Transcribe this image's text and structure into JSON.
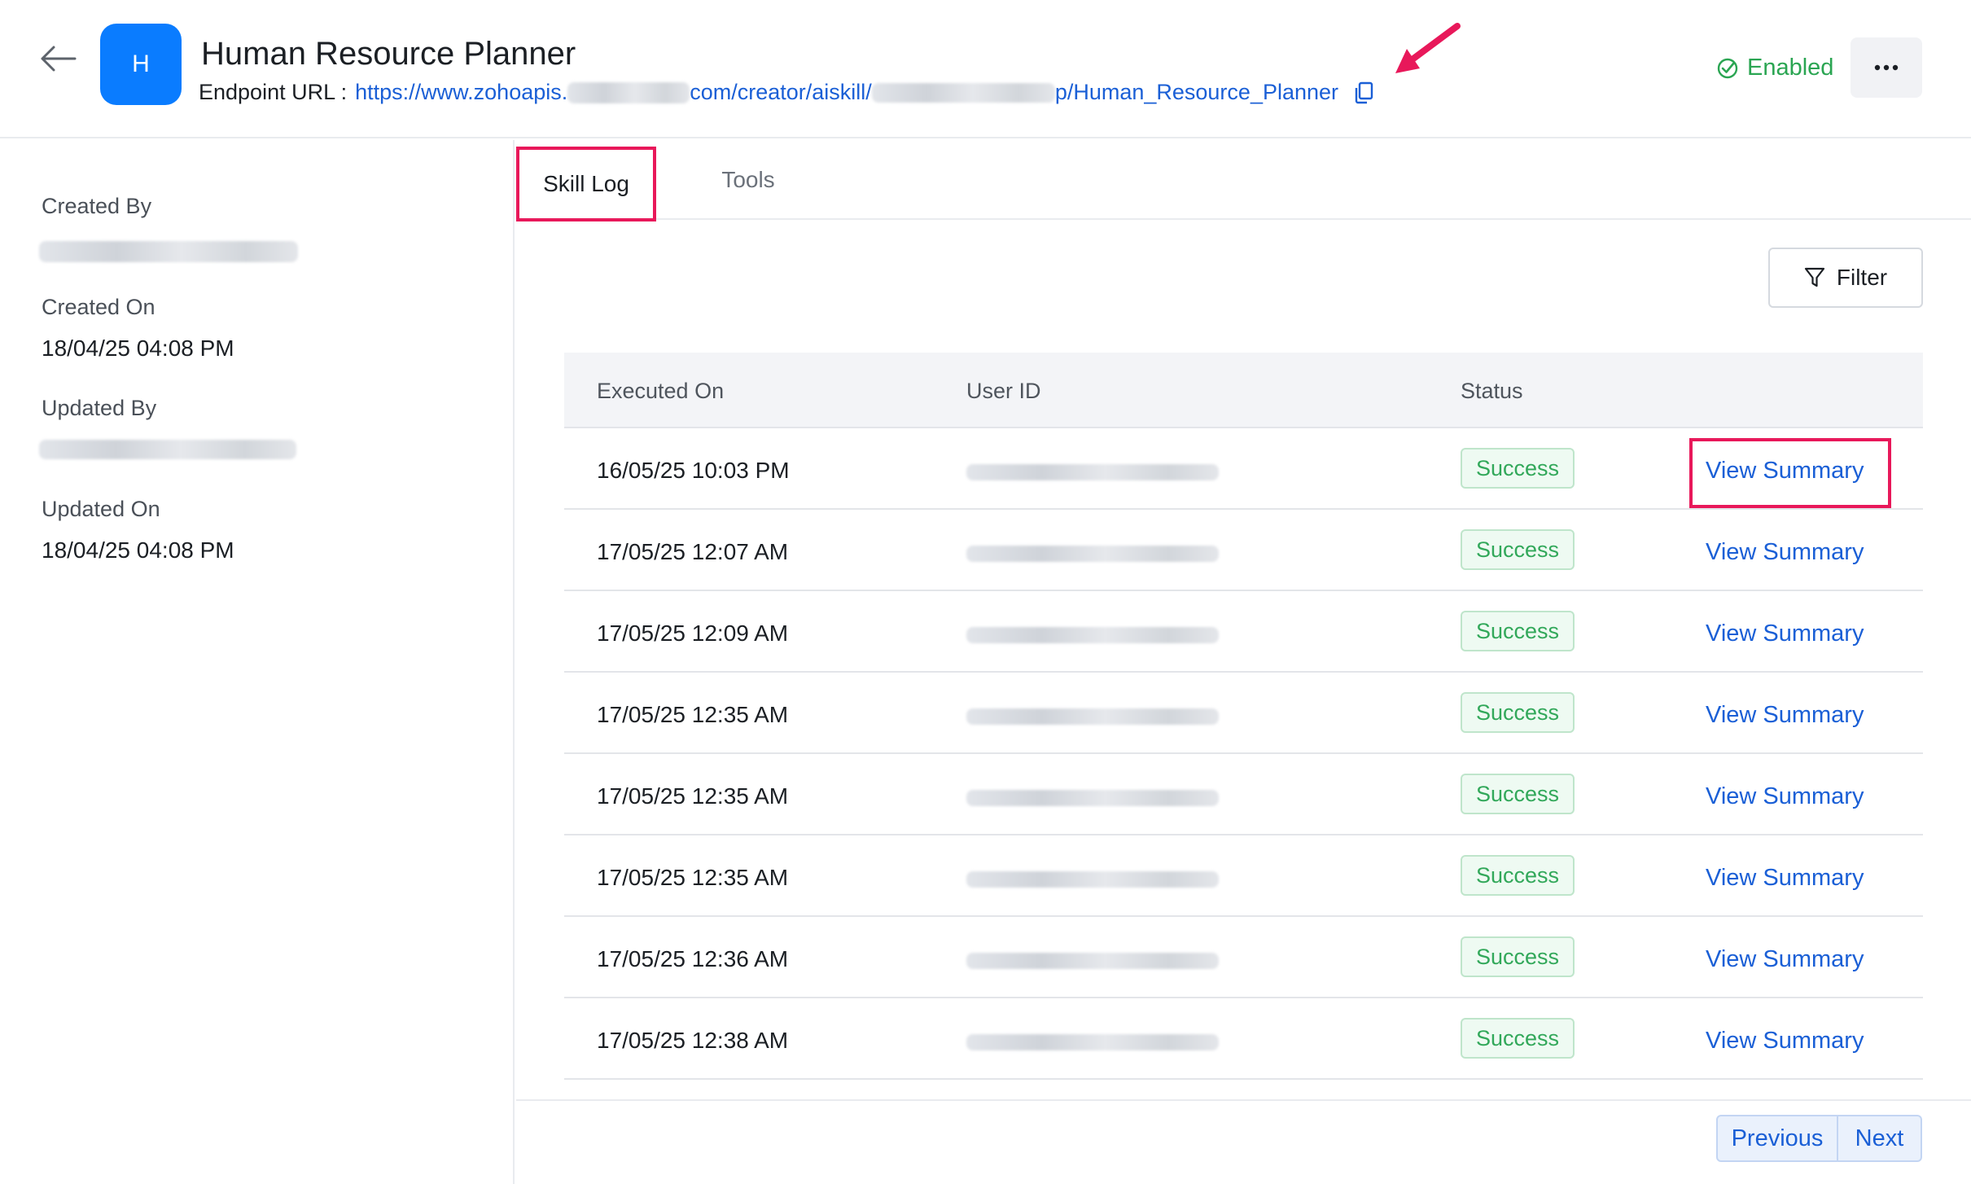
{
  "header": {
    "avatar_letter": "H",
    "title": "Human Resource Planner",
    "endpoint_label": "Endpoint URL :",
    "url_part1": "https://www.zohoapis.",
    "url_part2": "com/creator/aiskill/",
    "url_part3": "p/Human_Resource_Planner",
    "status": "Enabled",
    "status_color": "#2aa552"
  },
  "meta": {
    "created_by_label": "Created By",
    "created_on_label": "Created On",
    "created_on": "18/04/25 04:08 PM",
    "updated_by_label": "Updated By",
    "updated_on_label": "Updated On",
    "updated_on": "18/04/25 04:08 PM"
  },
  "tabs": [
    {
      "label": "Skill Log",
      "active": true
    },
    {
      "label": "Tools",
      "active": false
    }
  ],
  "filter_label": "Filter",
  "table": {
    "columns": [
      "Executed On",
      "User ID",
      "Status"
    ],
    "rows": [
      {
        "executed_on": "16/05/25 10:03 PM",
        "status": "Success",
        "action": "View Summary"
      },
      {
        "executed_on": "17/05/25 12:07 AM",
        "status": "Success",
        "action": "View Summary"
      },
      {
        "executed_on": "17/05/25 12:09 AM",
        "status": "Success",
        "action": "View Summary"
      },
      {
        "executed_on": "17/05/25 12:35 AM",
        "status": "Success",
        "action": "View Summary"
      },
      {
        "executed_on": "17/05/25 12:35 AM",
        "status": "Success",
        "action": "View Summary"
      },
      {
        "executed_on": "17/05/25 12:35 AM",
        "status": "Success",
        "action": "View Summary"
      },
      {
        "executed_on": "17/05/25 12:36 AM",
        "status": "Success",
        "action": "View Summary"
      },
      {
        "executed_on": "17/05/25 12:38 AM",
        "status": "Success",
        "action": "View Summary"
      }
    ]
  },
  "pagination": {
    "previous": "Previous",
    "next": "Next"
  },
  "colors": {
    "accent_link": "#1a5fd6",
    "avatar_bg": "#0a7cff",
    "annotation_highlight": "#e8185a",
    "success": "#32a85a"
  }
}
